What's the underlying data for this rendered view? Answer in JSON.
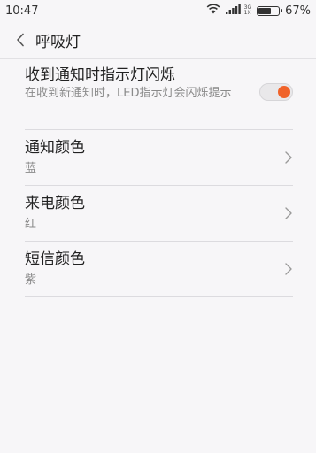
{
  "status_bar": {
    "time": "10:47",
    "net_top": "3G",
    "net_bottom": "1X",
    "battery_level": 0.67,
    "battery_text": "67%"
  },
  "header": {
    "title": "呼吸灯"
  },
  "settings": {
    "notification_light": {
      "label": "收到通知时指示灯闪烁",
      "description": "在收到新通知时，LED指示灯会闪烁提示",
      "enabled": true
    },
    "notification_color": {
      "label": "通知颜色",
      "value": "蓝"
    },
    "call_color": {
      "label": "来电颜色",
      "value": "红"
    },
    "sms_color": {
      "label": "短信颜色",
      "value": "紫"
    }
  },
  "colors": {
    "accent": "#f0632a",
    "background": "#f7f6f8"
  }
}
